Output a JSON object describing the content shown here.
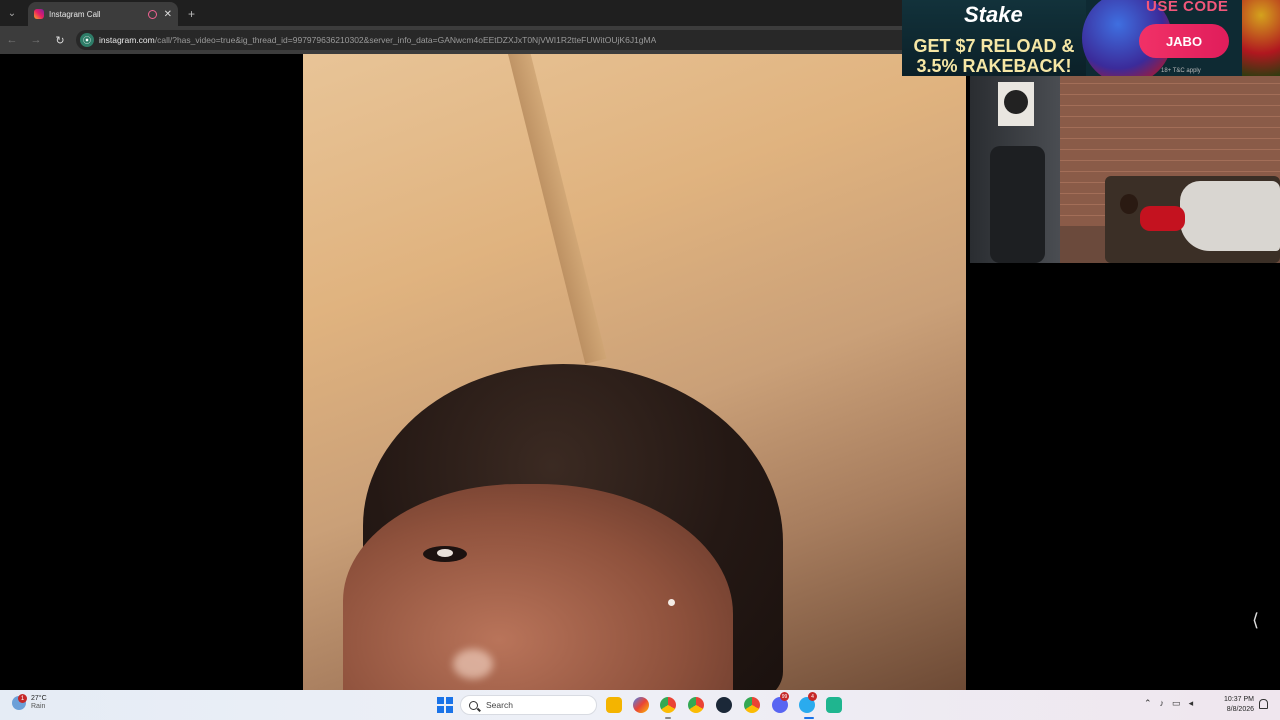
{
  "browser": {
    "tab_title": "Instagram Call",
    "new_tab": "+",
    "close": "✕",
    "url_host": "instagram.com",
    "url_path": "/call/?has_video=true&ig_thread_id=997979636210302&server_info_data=GANwcm4oEEtDZXJxT0NjVWI1R2tteFUWitOUjK6J1gMA"
  },
  "overlay_ad": {
    "brand": "Stake",
    "line1": "GET $7 RELOAD &",
    "line2": "3.5% RAKEBACK!",
    "use_code_label": "USE CODE",
    "code": "JABO",
    "terms": "18+ T&C apply"
  },
  "taskbar": {
    "weather_temp": "27°C",
    "weather_condition": "Rain",
    "weather_badge": "1",
    "search_label": "Search",
    "clock_time": "10:37 PM",
    "clock_date": "8/8/2026",
    "discord_badge": "99",
    "telegram_badge": "4"
  },
  "colors": {
    "accent": "#1a73e8",
    "badge": "#c62828",
    "ad_code_button": "#f13167"
  }
}
